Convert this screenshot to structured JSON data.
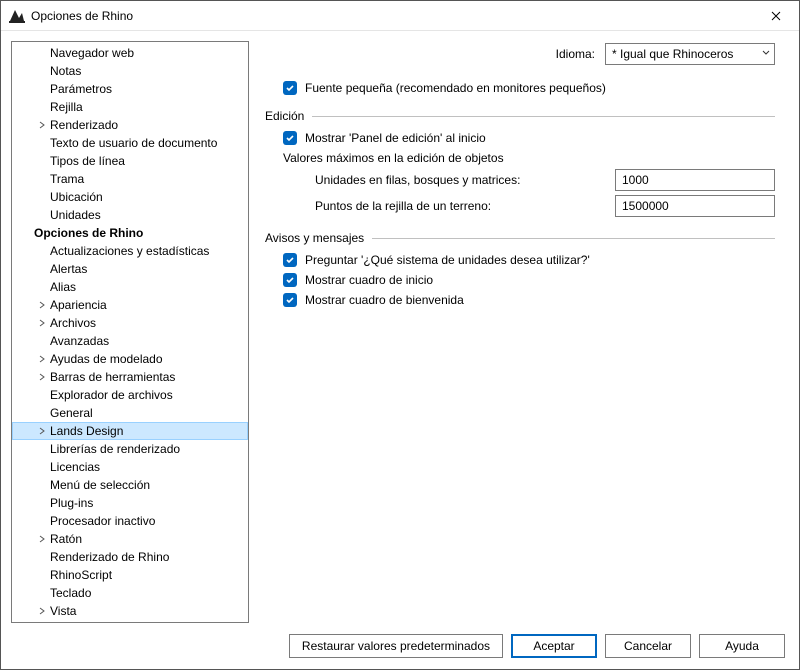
{
  "window": {
    "title": "Opciones de Rhino"
  },
  "tree": {
    "doc_items": [
      {
        "label": "Navegador web",
        "expandable": false
      },
      {
        "label": "Notas",
        "expandable": false
      },
      {
        "label": "Parámetros",
        "expandable": false
      },
      {
        "label": "Rejilla",
        "expandable": false
      },
      {
        "label": "Renderizado",
        "expandable": true
      },
      {
        "label": "Texto de usuario de documento",
        "expandable": false
      },
      {
        "label": "Tipos de línea",
        "expandable": false
      },
      {
        "label": "Trama",
        "expandable": false
      },
      {
        "label": "Ubicación",
        "expandable": false
      },
      {
        "label": "Unidades",
        "expandable": false
      }
    ],
    "root_label": "Opciones de Rhino",
    "rhino_items": [
      {
        "label": "Actualizaciones y estadísticas",
        "expandable": false
      },
      {
        "label": "Alertas",
        "expandable": false
      },
      {
        "label": "Alias",
        "expandable": false
      },
      {
        "label": "Apariencia",
        "expandable": true
      },
      {
        "label": "Archivos",
        "expandable": true
      },
      {
        "label": "Avanzadas",
        "expandable": false
      },
      {
        "label": "Ayudas de modelado",
        "expandable": true
      },
      {
        "label": "Barras de herramientas",
        "expandable": true
      },
      {
        "label": "Explorador de archivos",
        "expandable": false
      },
      {
        "label": "General",
        "expandable": false
      },
      {
        "label": "Lands Design",
        "expandable": true,
        "selected": true
      },
      {
        "label": "Librerías de renderizado",
        "expandable": false
      },
      {
        "label": "Licencias",
        "expandable": false
      },
      {
        "label": "Menú de selección",
        "expandable": false
      },
      {
        "label": "Plug-ins",
        "expandable": false
      },
      {
        "label": "Procesador inactivo",
        "expandable": false
      },
      {
        "label": "Ratón",
        "expandable": true
      },
      {
        "label": "Renderizado de Rhino",
        "expandable": false
      },
      {
        "label": "RhinoScript",
        "expandable": false
      },
      {
        "label": "Teclado",
        "expandable": false
      },
      {
        "label": "Vista",
        "expandable": true
      }
    ]
  },
  "content": {
    "language_label": "Idioma:",
    "language_value": "* Igual que Rhinoceros",
    "small_font": "Fuente pequeña (recomendado en monitores pequeños)",
    "edition_header": "Edición",
    "show_edit_panel": "Mostrar 'Panel de edición' al inicio",
    "max_values_label": "Valores máximos en la edición de objetos",
    "units_label": "Unidades en filas, bosques y matrices:",
    "units_value": "1000",
    "terrain_label": "Puntos de la rejilla de un terreno:",
    "terrain_value": "1500000",
    "notices_header": "Avisos y mensajes",
    "ask_units": "Preguntar '¿Qué sistema de unidades desea utilizar?'",
    "show_start": "Mostrar cuadro de inicio",
    "show_welcome": "Mostrar cuadro de bienvenida"
  },
  "footer": {
    "restore": "Restaurar valores predeterminados",
    "accept": "Aceptar",
    "cancel": "Cancelar",
    "help": "Ayuda"
  }
}
